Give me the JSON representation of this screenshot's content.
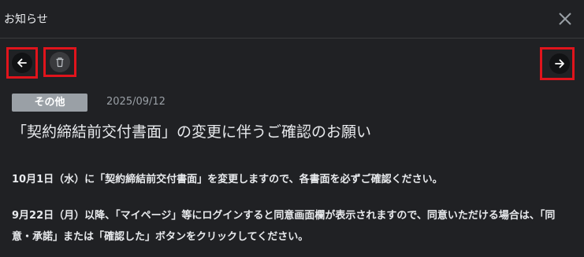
{
  "header": {
    "title": "お知らせ",
    "close_icon": "close-icon"
  },
  "toolbar": {
    "back_icon": "arrow-left-icon",
    "delete_icon": "trash-icon",
    "next_icon": "arrow-right-icon",
    "highlight_color": "#e0141c"
  },
  "notice": {
    "category": "その他",
    "date": "2025/09/12",
    "title": "「契約締結前交付書面」の変更に伴うご確認のお願い",
    "paragraphs": [
      "10月1日（水）に「契約締結前交付書面」を変更しますので、各書面を必ずご確認ください。",
      "9月22日（月）以降、「マイページ」等にログインすると同意画面欄が表示されますので、同意いただける場合は、「同意・承諾」または「確認した」ボタンをクリックしてください。"
    ]
  },
  "colors": {
    "background": "#202124",
    "badge": "#9aa0a6",
    "text": "#e8eaed"
  }
}
